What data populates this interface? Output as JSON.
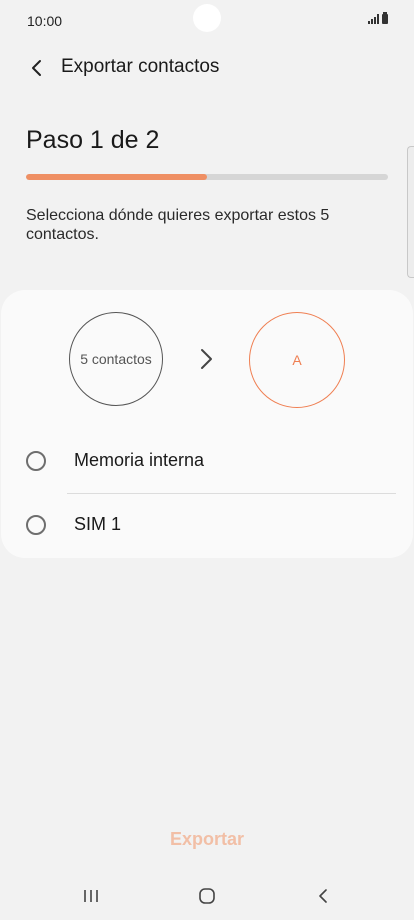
{
  "status_bar": {
    "time": "10:00"
  },
  "app_bar": {
    "title": "Exportar contactos",
    "back_icon": "chevron-left-icon"
  },
  "wizard": {
    "step_label": "Paso 1 de 2",
    "progress": 0.5,
    "description": "Selecciona dónde quieres exportar estos 5 contactos."
  },
  "export_card": {
    "source_label": "5 contactos",
    "target_label": "A",
    "arrow_icon": "chevron-right-icon",
    "options": [
      {
        "label": "Memoria interna",
        "selected": false
      },
      {
        "label": "SIM 1",
        "selected": false
      }
    ]
  },
  "footer": {
    "export_label": "Exportar"
  },
  "nav_bar": {
    "icons": [
      "recent-apps-icon",
      "home-icon",
      "back-icon"
    ]
  },
  "colors": {
    "accent": "#ef8f63",
    "accent_disabled": "#f2bfa6",
    "background": "#f2f2f2",
    "card": "#fafafa"
  }
}
